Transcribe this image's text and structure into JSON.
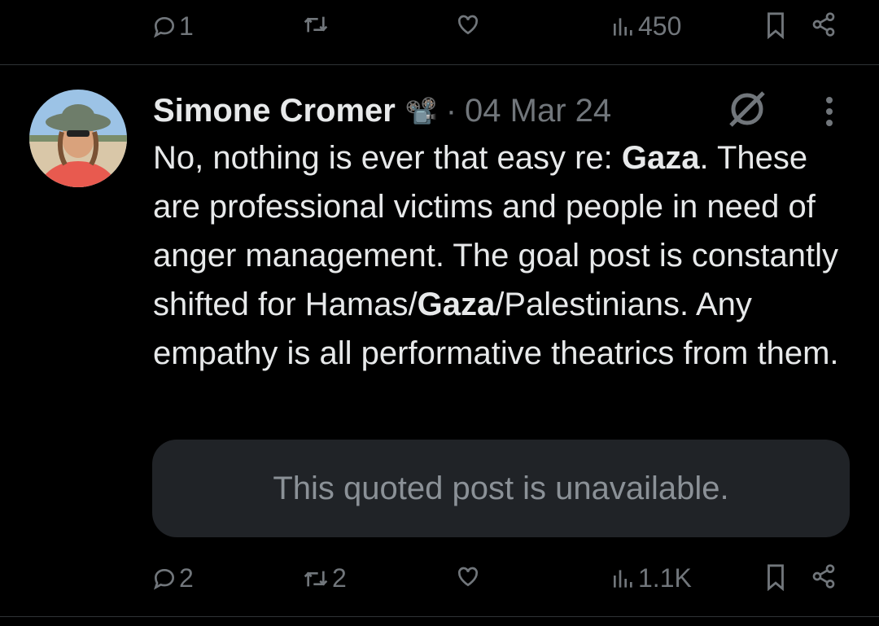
{
  "top_actions": {
    "reply_count": "1",
    "retweet_count": "",
    "like_count": "",
    "views_count": "450"
  },
  "post": {
    "author_name": "Simone Cromer",
    "badge_emoji": "📽️",
    "separator": "·",
    "date": "04 Mar 24",
    "body_segments": [
      {
        "text": "No, nothing is ever that easy re: ",
        "bold": false
      },
      {
        "text": "Gaza",
        "bold": true
      },
      {
        "text": ". These are professional victims and people in need of anger management. The goal post is constantly shifted for Hamas/",
        "bold": false
      },
      {
        "text": "Gaza",
        "bold": true
      },
      {
        "text": "/Palestinians. Any empathy is all performative theatrics from them.",
        "bold": false
      }
    ],
    "quoted_post_text": "This quoted post is unavailable.",
    "actions": {
      "reply_count": "2",
      "retweet_count": "2",
      "like_count": "",
      "views_count": "1.1K"
    }
  },
  "icons": {
    "reply": "speech-bubble-icon",
    "retweet": "retweet-icon",
    "like": "heart-icon",
    "views": "bar-chart-icon",
    "bookmark": "bookmark-icon",
    "share": "share-icon",
    "more": "vertical-dots-icon",
    "muted": "crossed-circle-icon"
  },
  "colors": {
    "background": "#000000",
    "text_primary": "#e7e9ea",
    "text_secondary": "#71767b",
    "quote_bg": "#202327",
    "divider": "#2f3336"
  }
}
